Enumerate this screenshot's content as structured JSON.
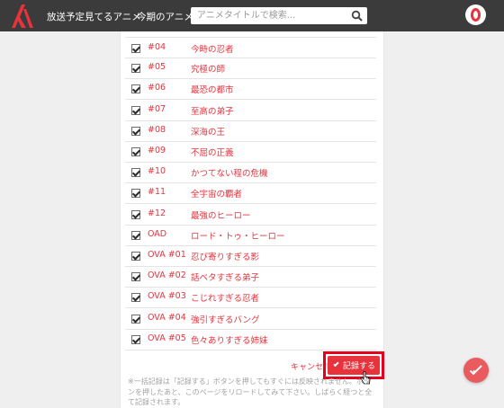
{
  "header": {
    "logo_icon": "anime-logo-icon",
    "nav": [
      "放送予定",
      "見てるアニメ",
      "今期のアニメ"
    ],
    "search_placeholder": "アニメタイトルで検索...",
    "search_icon": "search-icon",
    "avatar_icon": "user-avatar-icon"
  },
  "episodes": [
    {
      "number": "#04",
      "title": "今時の忍者",
      "checked": true
    },
    {
      "number": "#05",
      "title": "究極の師",
      "checked": true
    },
    {
      "number": "#06",
      "title": "最恐の都市",
      "checked": true
    },
    {
      "number": "#07",
      "title": "至高の弟子",
      "checked": true
    },
    {
      "number": "#08",
      "title": "深海の王",
      "checked": true
    },
    {
      "number": "#09",
      "title": "不屈の正義",
      "checked": true
    },
    {
      "number": "#10",
      "title": "かつてない程の危機",
      "checked": true
    },
    {
      "number": "#11",
      "title": "全宇宙の覇者",
      "checked": true
    },
    {
      "number": "#12",
      "title": "最強のヒーロー",
      "checked": true
    },
    {
      "number": "OAD",
      "title": "ロード・トゥ・ヒーロー",
      "checked": true
    },
    {
      "number": "OVA #01",
      "title": "忍び寄りすぎる影",
      "checked": true
    },
    {
      "number": "OVA #02",
      "title": "話ベタすぎる弟子",
      "checked": true
    },
    {
      "number": "OVA #03",
      "title": "こじれすぎる忍者",
      "checked": true
    },
    {
      "number": "OVA #04",
      "title": "強引すぎるバング",
      "checked": true
    },
    {
      "number": "OVA #05",
      "title": "色々ありすぎる姉妹",
      "checked": true
    }
  ],
  "actions": {
    "cancel_label": "キャンセル",
    "record_label": "記録する"
  },
  "note": "※一括記録は「記録する」ボタンを押してもすぐには反映されません。ボタンを押したあと、このページをリロードしてみて下さい。しばらく経つと全て記録されます。",
  "colors": {
    "accent": "#e8323c",
    "header_bg": "#3b3b3b",
    "highlight_box": "#e5001b",
    "fab": "#ea5a5f"
  }
}
